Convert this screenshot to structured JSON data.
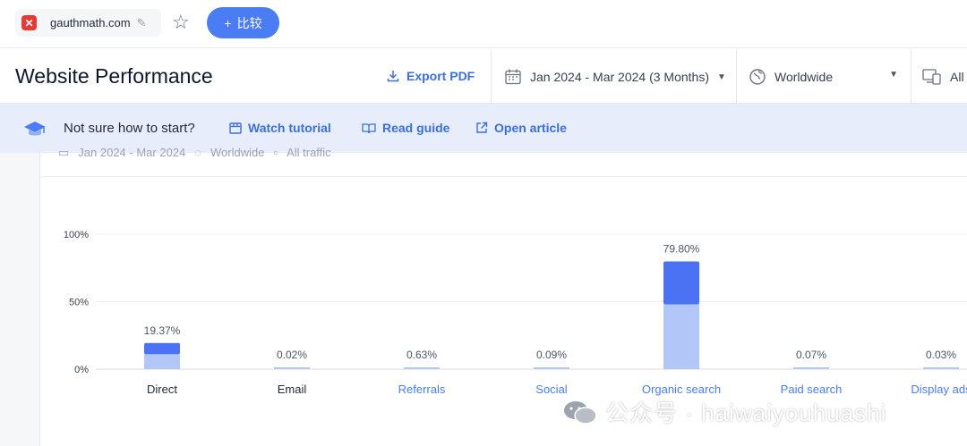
{
  "topbar": {
    "site_name": "gauthmath.com",
    "compare_label": "比较",
    "favicon_glyph": "✕"
  },
  "header": {
    "title": "Website Performance",
    "export_label": "Export PDF",
    "date_range": "Jan 2024 - Mar 2024 (3 Months)",
    "geo": "Worldwide",
    "traffic": "All"
  },
  "banner": {
    "text": "Not sure how to start?",
    "watch": "Watch tutorial",
    "read": "Read guide",
    "open": "Open article"
  },
  "substrip": {
    "date": "Jan 2024 - Mar 2024",
    "geo": "Worldwide",
    "traffic": "All traffic"
  },
  "chart_data": {
    "type": "bar",
    "categories": [
      "Direct",
      "Email",
      "Referrals",
      "Social",
      "Organic search",
      "Paid search",
      "Display ads"
    ],
    "values": [
      19.37,
      0.02,
      0.63,
      0.09,
      79.8,
      0.07,
      0.03
    ],
    "value_labels": [
      "19.37%",
      "0.02%",
      "0.63%",
      "0.09%",
      "79.80%",
      "0.07%",
      "0.03%"
    ],
    "lighter_segment_values": [
      11,
      0.02,
      0.63,
      0.09,
      48,
      0.07,
      0.03
    ],
    "ylim": [
      0,
      100
    ],
    "yticks": [
      "0%",
      "50%",
      "100%"
    ],
    "colors": {
      "dark": "#4a72f2",
      "light": "#b2c7f7",
      "link": "#4a7cf3",
      "text": "#1f2937"
    },
    "link_categories": [
      "Referrals",
      "Social",
      "Organic search",
      "Paid search",
      "Display ads"
    ]
  },
  "watermark": {
    "text": "公众号 · haiwaiyouhuashi"
  }
}
